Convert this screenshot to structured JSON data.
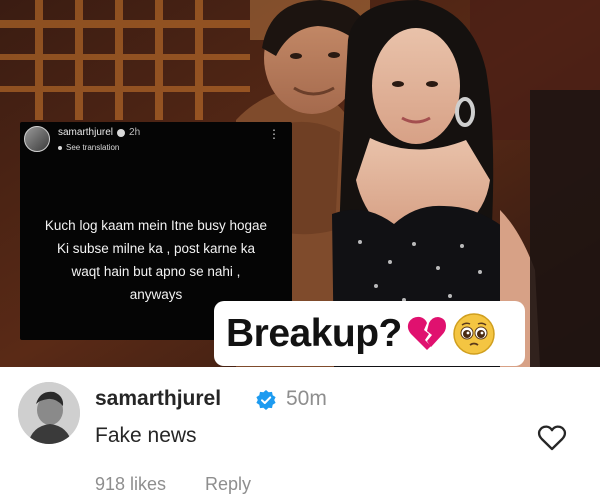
{
  "post": {
    "overlay_caption": "Breakup?",
    "emoji": [
      "broken-heart-icon",
      "pleading-face-icon"
    ],
    "story": {
      "username": "samarthjurel",
      "time": "2h",
      "translate_label": "See translation",
      "lines": [
        "Kuch log kaam mein Itne busy hogae",
        "Ki subse milne ka , post karne ka",
        "waqt hain but apno se nahi ,",
        "anyways"
      ]
    }
  },
  "comment": {
    "username": "samarthjurel",
    "verified": true,
    "time": "50m",
    "text": "Fake news",
    "likes": "918 likes",
    "reply_label": "Reply",
    "like_icon": "heart-outline-icon"
  },
  "colors": {
    "verified_blue": "#1d9bf0",
    "username_text": "#262626",
    "secondary_text": "#8e8e8e",
    "broken_heart": "#e0116f"
  }
}
